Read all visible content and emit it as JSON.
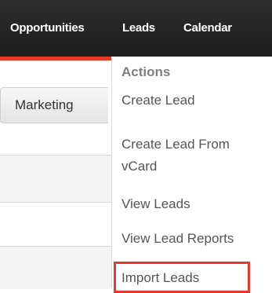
{
  "navbar": {
    "items": [
      {
        "label": "Opportunities"
      },
      {
        "label": "Leads"
      },
      {
        "label": "Calendar"
      }
    ],
    "accent_color": "#e63a2a"
  },
  "tabs": {
    "marketing_label": "Marketing"
  },
  "leads_menu": {
    "header": "Actions",
    "items": [
      {
        "label": "Create Lead"
      },
      {
        "label": "Create Lead From vCard"
      },
      {
        "label": "View Leads"
      },
      {
        "label": "View Lead Reports"
      },
      {
        "label": "Import Leads"
      }
    ],
    "highlight_color": "#e53b2c"
  }
}
